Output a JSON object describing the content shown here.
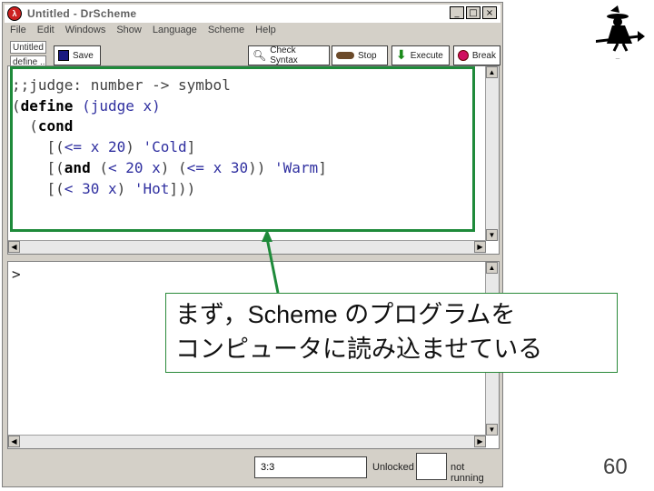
{
  "window": {
    "title": "Untitled - DrScheme",
    "minimize_glyph": "_",
    "maximize_glyph": "□",
    "close_glyph": "×"
  },
  "menubar": [
    "File",
    "Edit",
    "Windows",
    "Show",
    "Language",
    "Scheme",
    "Help"
  ],
  "tabs": {
    "tab1": "Untitled",
    "tab2": "define ..."
  },
  "toolbar": {
    "save": "Save",
    "check_syntax": "Check Syntax",
    "stop": "Stop",
    "execute": "Execute",
    "break": "Break"
  },
  "definitions": {
    "lines": [
      ";;judge: number -> symbol",
      "(define (judge x)",
      "  (cond",
      "    [(<= x 20) 'Cold]",
      "    [(and (< 20 x) (<= x 30)) 'Warm]",
      "    [(< 30 x) 'Hot]))"
    ]
  },
  "interactions": {
    "prompt": ">"
  },
  "status": {
    "position": "3:3",
    "lock": "Unlocked",
    "running": "not running"
  },
  "callout": {
    "line1": "まず，Scheme のプログラムを",
    "line2": "コンピュータに読み込ませている"
  },
  "slide": {
    "page_number": "60"
  },
  "colors": {
    "highlight": "#1e8a3a",
    "keyword": "#000000",
    "literal": "#3030a0"
  },
  "icons": {
    "app": "drscheme-lambda-icon",
    "save": "save-icon",
    "check_syntax": "magnifier-icon",
    "stop": "stop-icon",
    "execute": "execute-arrow-icon",
    "break": "break-icon",
    "logo": "witch-logo"
  }
}
